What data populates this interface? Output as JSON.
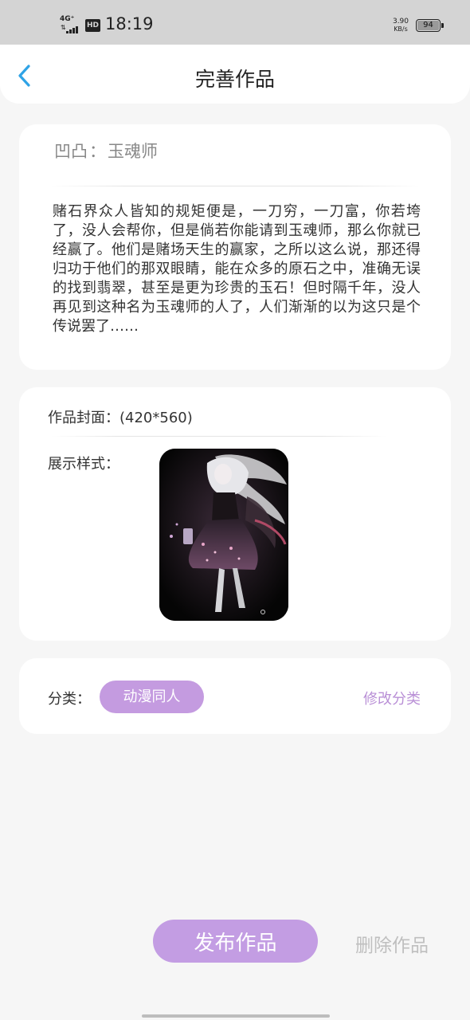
{
  "status_bar": {
    "network": "4G⁺",
    "hd_badge": "HD",
    "time": "18:19",
    "speed_value": "3.90",
    "speed_unit": "KB/s",
    "battery": "94"
  },
  "header": {
    "title": "完善作品",
    "back_icon": "chevron-left-icon"
  },
  "work": {
    "prefix": "凹凸",
    "separator": "：",
    "title": "玉魂师",
    "description": "赌石界众人皆知的规矩便是，一刀穷，一刀富，你若垮了，没人会帮你，但是倘若你能请到玉魂师，那么你就已经赢了。他们是赌场天生的赢家，之所以这么说，那还得归功于他们的那双眼睛，能在众多的原石之中，准确无误的找到翡翠，甚至是更为珍贵的玉石！但时隔千年，没人再见到这种名为玉魂师的人了，人们渐渐的以为这只是个传说罢了……"
  },
  "cover": {
    "label": "作品封面：(420*560)",
    "style_label": "展示样式："
  },
  "category": {
    "label": "分类：",
    "value": "动漫同人",
    "edit_label": "修改分类"
  },
  "actions": {
    "publish_label": "发布作品",
    "delete_label": "删除作品"
  },
  "colors": {
    "accent": "#c39de3",
    "accent_text": "#b98fd6",
    "back_icon": "#2fa3e6"
  }
}
